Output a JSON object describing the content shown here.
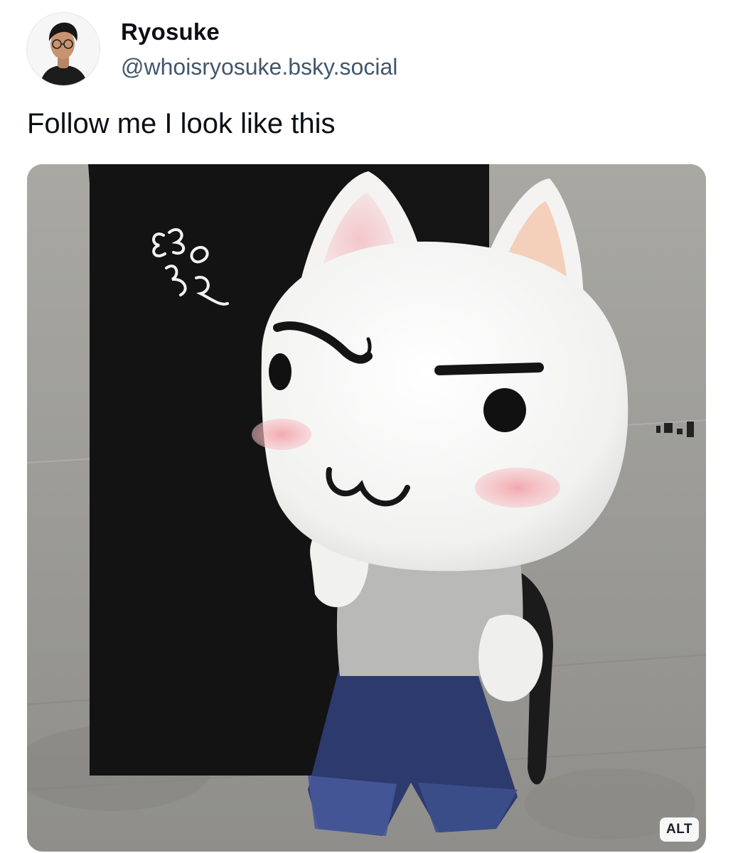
{
  "author": {
    "display_name": "Ryosuke",
    "handle": "@whoisryosuke.bsky.social",
    "avatar_icon": "person-portrait"
  },
  "post": {
    "text": "Follow me I look like this"
  },
  "media": {
    "alt_badge": "ALT",
    "image_subject": "toro-cat-plush-photo"
  },
  "colors": {
    "text_primary": "#0b0f14",
    "text_secondary": "#42576c",
    "cat_blush": "#f2a7ae",
    "cat_ear_inner": "#f3c9b2"
  }
}
